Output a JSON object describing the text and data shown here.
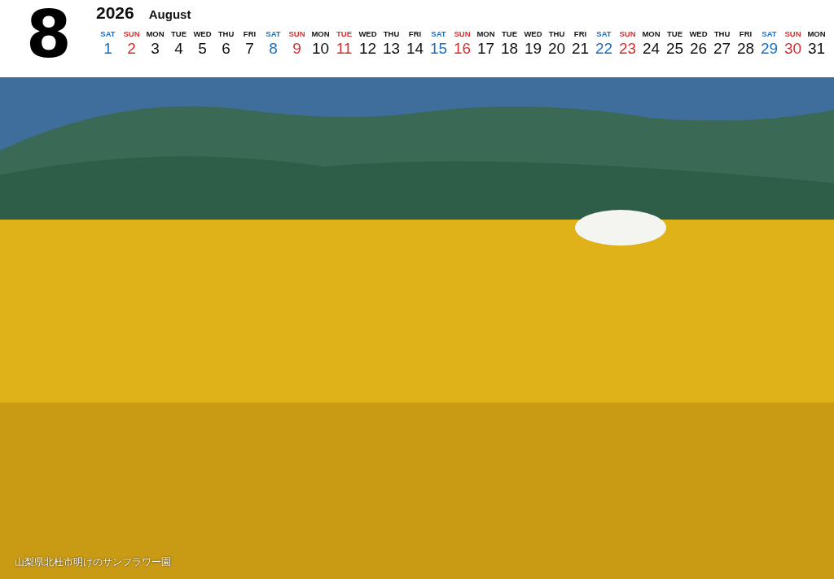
{
  "month_number": "8",
  "year": "2026",
  "month_name": "August",
  "days": [
    {
      "weekday": "SAT",
      "date": "1",
      "color": "#1a6fc0"
    },
    {
      "weekday": "SUN",
      "date": "2",
      "color": "#d63030"
    },
    {
      "weekday": "MON",
      "date": "3",
      "color": "#111111"
    },
    {
      "weekday": "TUE",
      "date": "4",
      "color": "#111111"
    },
    {
      "weekday": "WED",
      "date": "5",
      "color": "#111111"
    },
    {
      "weekday": "THU",
      "date": "6",
      "color": "#111111"
    },
    {
      "weekday": "FRI",
      "date": "7",
      "color": "#111111"
    },
    {
      "weekday": "SAT",
      "date": "8",
      "color": "#1a6fc0"
    },
    {
      "weekday": "SUN",
      "date": "9",
      "color": "#d63030"
    },
    {
      "weekday": "MON",
      "date": "10",
      "color": "#111111"
    },
    {
      "weekday": "TUE",
      "date": "11",
      "color": "#d63030"
    },
    {
      "weekday": "WED",
      "date": "12",
      "color": "#111111"
    },
    {
      "weekday": "THU",
      "date": "13",
      "color": "#111111"
    },
    {
      "weekday": "FRI",
      "date": "14",
      "color": "#111111"
    },
    {
      "weekday": "SAT",
      "date": "15",
      "color": "#1a6fc0"
    },
    {
      "weekday": "SUN",
      "date": "16",
      "color": "#d63030"
    },
    {
      "weekday": "MON",
      "date": "17",
      "color": "#111111"
    },
    {
      "weekday": "TUE",
      "date": "18",
      "color": "#111111"
    },
    {
      "weekday": "WED",
      "date": "19",
      "color": "#111111"
    },
    {
      "weekday": "THU",
      "date": "20",
      "color": "#111111"
    },
    {
      "weekday": "FRI",
      "date": "21",
      "color": "#111111"
    },
    {
      "weekday": "SAT",
      "date": "22",
      "color": "#1a6fc0"
    },
    {
      "weekday": "SUN",
      "date": "23",
      "color": "#d63030"
    },
    {
      "weekday": "MON",
      "date": "24",
      "color": "#111111"
    },
    {
      "weekday": "TUE",
      "date": "25",
      "color": "#111111"
    },
    {
      "weekday": "WED",
      "date": "26",
      "color": "#111111"
    },
    {
      "weekday": "THU",
      "date": "27",
      "color": "#111111"
    },
    {
      "weekday": "FRI",
      "date": "28",
      "color": "#111111"
    },
    {
      "weekday": "SAT",
      "date": "29",
      "color": "#1a6fc0"
    },
    {
      "weekday": "SUN",
      "date": "30",
      "color": "#d63030"
    },
    {
      "weekday": "MON",
      "date": "31",
      "color": "#111111"
    }
  ],
  "photo": {
    "caption": "山梨県北杜市明けのサンフラワー園"
  }
}
